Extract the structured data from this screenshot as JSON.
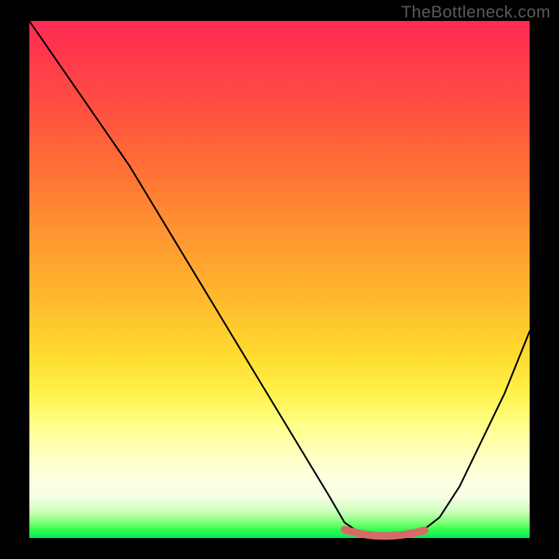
{
  "watermark": "TheBottleneck.com",
  "chart_data": {
    "type": "line",
    "title": "",
    "xlabel": "",
    "ylabel": "",
    "xlim": [
      0,
      100
    ],
    "ylim": [
      0,
      100
    ],
    "grid": false,
    "legend": false,
    "series": [
      {
        "name": "bottleneck-curve",
        "x": [
          0,
          5,
          10,
          15,
          20,
          25,
          30,
          35,
          40,
          45,
          50,
          55,
          60,
          63,
          66,
          70,
          74,
          78,
          82,
          86,
          90,
          95,
          100
        ],
        "y": [
          100,
          93,
          86,
          79,
          72,
          64,
          56,
          48,
          40,
          32,
          24,
          16,
          8,
          3,
          1,
          0,
          0,
          1,
          4,
          10,
          18,
          28,
          40
        ]
      }
    ],
    "highlight_range": {
      "name": "optimal-range",
      "x_start": 63,
      "x_end": 79,
      "y": 0
    },
    "colors": {
      "gradient_top": "#ff2a55",
      "gradient_mid": "#ffd92e",
      "gradient_bottom": "#08e85a",
      "curve": "#000000",
      "highlight": "#d86a66"
    }
  }
}
